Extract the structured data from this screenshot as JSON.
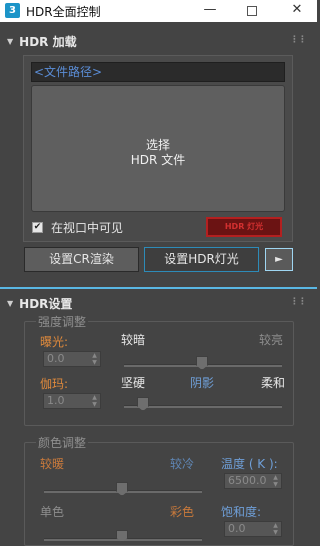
{
  "window": {
    "title": "HDR全面控制",
    "min_glyph": "—",
    "close_glyph": "✕"
  },
  "hdr_load": {
    "header": "HDR 加载",
    "arrow": "▼",
    "grip": "⋮⋮",
    "path_placeholder": "<文件路径>",
    "preview_line1": "选择",
    "preview_line2": "HDR 文件",
    "viewport_visible_label": "在视口中可见",
    "viewport_visible_checked": "✔",
    "warning_text": "HDR 灯光",
    "setup_cr_render_label": "设置CR渲染",
    "setup_hdr_light_label": "设置HDR灯光",
    "arrow_button_glyph": "►"
  },
  "hdr_settings": {
    "header": "HDR设置",
    "arrow": "▼",
    "grip": "⋮⋮",
    "intensity_group": {
      "title": "强度调整",
      "exposure_label": "曝光:",
      "exposure_value": "0.0",
      "darker_label": "较暗",
      "brighter_label": "较亮",
      "exposure_slider_level": 0.5,
      "gamma_label": "伽玛:",
      "gamma_value": "1.0",
      "hard_label": "坚硬",
      "shadow_label": "阴影",
      "soft_label": "柔和",
      "gamma_slider_level": 0.12
    },
    "color_group": {
      "title": "颜色调整",
      "warmer_label": "较暖",
      "cooler_label": "较冷",
      "temperature_label": "温度 ( K ):",
      "temperature_value": "6500.0",
      "temperature_slider_level": 0.5,
      "mono_label": "单色",
      "color_label": "彩色",
      "saturation_label": "饱和度:",
      "saturation_value": "0.0",
      "saturation_slider_level": 0.5
    }
  }
}
